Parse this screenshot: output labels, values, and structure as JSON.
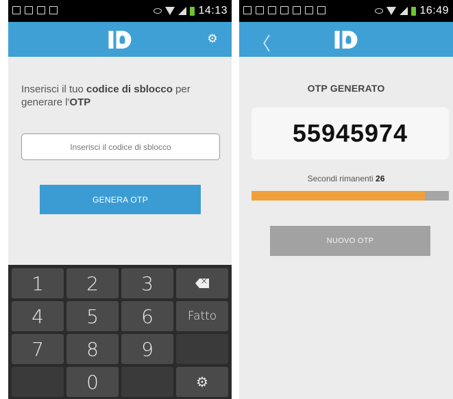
{
  "left": {
    "status_time": "14:13",
    "instructions": {
      "part1": "Inserisci il tuo ",
      "bold1": "codice di sblocco",
      "part2": " per generare l'",
      "bold2": "OTP"
    },
    "input_placeholder": "Inserisci il codice di sblocco",
    "generate_button": "GENERA OTP",
    "keyboard": {
      "keys": [
        "1",
        "2",
        "3",
        "4",
        "5",
        "6",
        "7",
        "8",
        "9",
        "0"
      ],
      "done_label": "Fatto"
    }
  },
  "right": {
    "status_time": "16:49",
    "otp_title": "OTP GENERATO",
    "otp_value": "55945974",
    "seconds_label": "Secondi rimanenti",
    "seconds_value": "26",
    "progress": 0.88,
    "new_button": "NUOVO OTP"
  },
  "colors": {
    "appbar": "#3fa0d6",
    "primary_button": "#3b9cd4",
    "progress_fill": "#f0a03b",
    "progress_track": "#a6a6a6",
    "disabled_button": "#a2a2a2"
  },
  "icons": [
    "settings-gear-icon",
    "back-chevron-icon",
    "backspace-icon",
    "keyboard-settings-icon"
  ]
}
